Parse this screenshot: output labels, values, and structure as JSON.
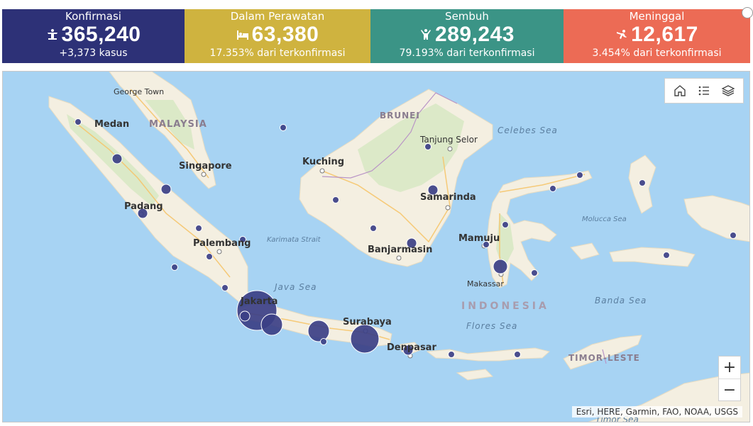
{
  "stats": [
    {
      "label": "Konfirmasi",
      "value": "365,240",
      "sub": "+3,373 kasus",
      "color": "#2d3177",
      "icon": "hospital-bed-person-icon"
    },
    {
      "label": "Dalam Perawatan",
      "value": "63,380",
      "sub": "17.353% dari terkonfirmasi",
      "color": "#cfb33f",
      "icon": "bed-icon"
    },
    {
      "label": "Sembuh",
      "value": "289,243",
      "sub": "79.193% dari terkonfirmasi",
      "color": "#3b9486",
      "icon": "celebrate-person-icon"
    },
    {
      "label": "Meninggal",
      "value": "12,617",
      "sub": "3.454% dari terkonfirmasi",
      "color": "#ec6b55",
      "icon": "falling-person-icon"
    }
  ],
  "map": {
    "labels": {
      "george_town": "George Town",
      "malaysia": "MALAYSIA",
      "medan": "Medan",
      "singapore": "Singapore",
      "padang": "Padang",
      "palembang": "Palembang",
      "brunei": "BRUNEI",
      "kuching": "Kuching",
      "tanjung_selor": "Tanjung Selor",
      "celebes_sea": "Celebes Sea",
      "samarinda": "Samarinda",
      "karimata_strait": "Karimata Strait",
      "banjarmasin": "Banjarmasin",
      "mamuju": "Mamuju",
      "molucca_sea": "Molucca Sea",
      "java_sea": "Java Sea",
      "makassar": "Makassar",
      "jakarta": "Jakarta",
      "indonesia": "INDONESIA",
      "banda_sea": "Banda Sea",
      "surabaya": "Surabaya",
      "flores_sea": "Flores Sea",
      "denpasar": "Denpasar",
      "timor_leste": "TIMOR-LESTE",
      "timor_sea": "Timor Sea"
    },
    "colors": {
      "water": "#a7d3f3",
      "land": "#f4efe1",
      "green": "#d7e8c3",
      "bubble": "#3b3f86",
      "road": "#f6c56c"
    },
    "attribution": "Esri, HERE, Garmin, FAO, NOAA, USGS",
    "zoom_in": "+",
    "zoom_out": "−"
  }
}
